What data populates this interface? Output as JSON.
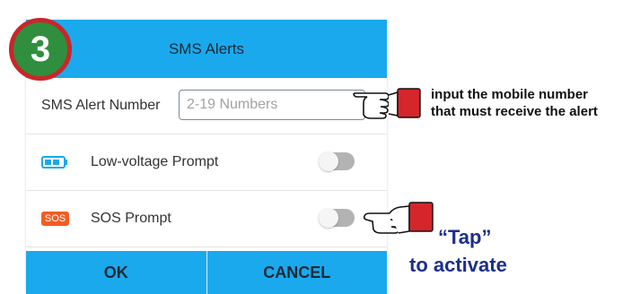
{
  "step_badge": "3",
  "dialog": {
    "title": "SMS Alerts",
    "sms_label": "SMS Alert Number",
    "sms_placeholder": "2-19 Numbers",
    "sms_value": "",
    "low_voltage_label": "Low-voltage Prompt",
    "low_voltage_enabled": false,
    "sos_badge": "SOS",
    "sos_label": "SOS Prompt",
    "sos_enabled": false,
    "ok_label": "OK",
    "cancel_label": "CANCEL"
  },
  "annotations": {
    "input_note_line1": "input the mobile number",
    "input_note_line2": "that must receive the alert",
    "tap_word": "“Tap”",
    "tap_activate": "to activate"
  },
  "colors": {
    "accent": "#1ba9ee",
    "sos_badge": "#f25d23",
    "badge_green": "#2f8f3e",
    "badge_ring": "#c9262a",
    "annotation_blue": "#1b2f8c",
    "cuff_red": "#d4262b"
  },
  "icons": {
    "battery": "battery-icon",
    "pointer": "pointing-hand-icon"
  }
}
